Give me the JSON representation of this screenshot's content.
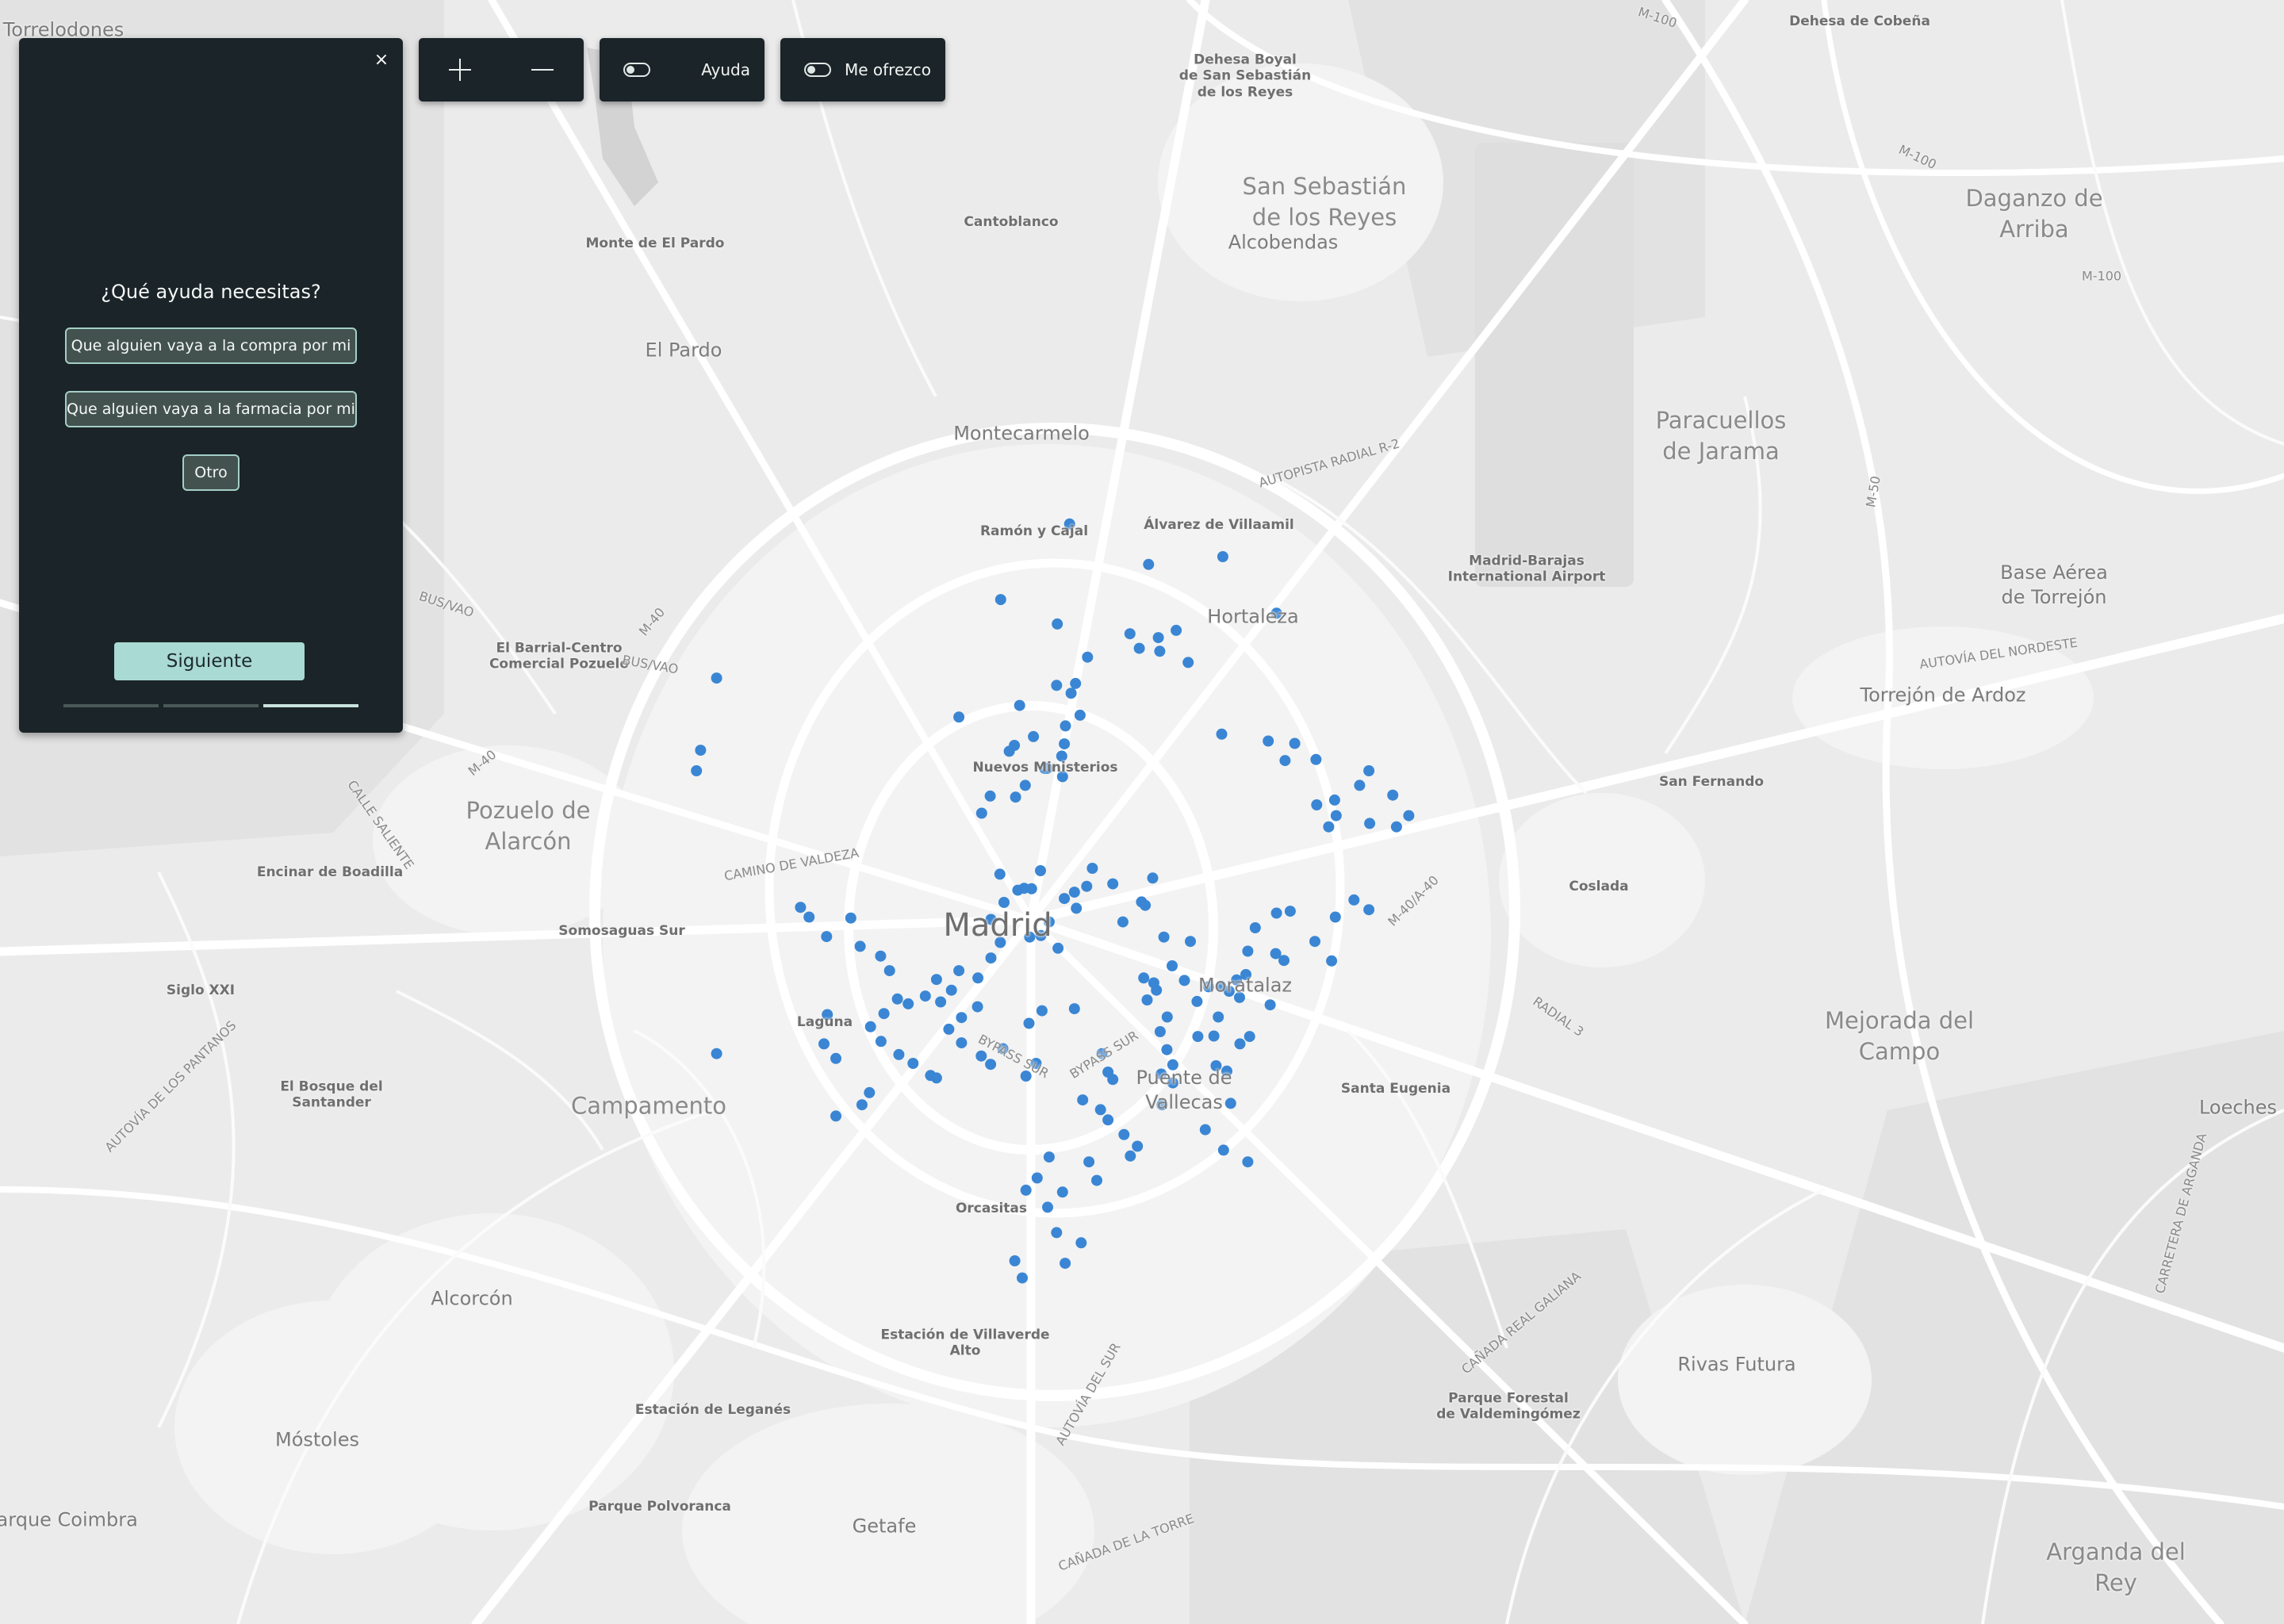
{
  "map": {
    "places": {
      "torrelodones": "Torrelodones",
      "dehesa_cobena": "Dehesa de Cobeña",
      "dehesa_boyal": "Dehesa Boyal\nde San Sebastián\nde los Reyes",
      "san_sebastian": "San Sebastián\nde los Reyes",
      "alcobendas": "Alcobendas",
      "daganzo": "Daganzo de\nArriba",
      "cantoblanco": "Cantoblanco",
      "monte_el_pardo": "Monte de El Pardo",
      "el_pardo": "El Pardo",
      "paracuellos": "Paracuellos\nde Jarama",
      "montecarmelo": "Montecarmelo",
      "ramon_y_cajal": "Ramón y Cajal",
      "alvarez_villaamil": "Álvarez de Villaamil",
      "madrid_barajas": "Madrid-Barajas\nInternational Airport",
      "base_aerea": "Base Aérea\nde Torrejón",
      "hortaleza": "Hortaleza",
      "el_barrial": "El Barrial-Centro\nComercial Pozuelo",
      "torrejon": "Torrejón de Ardoz",
      "nuevos_ministerios": "Nuevos Ministerios",
      "san_fernando": "San Fernando",
      "pozuelo": "Pozuelo de\nAlarcón",
      "encinar": "Encinar de Boadilla",
      "coslada": "Coslada",
      "somosaguas": "Somosaguas Sur",
      "madrid": "Madrid",
      "siglo_xxi": "Siglo XXI",
      "moratalaz": "Moratalaz",
      "laguna": "Laguna",
      "mejorada": "Mejorada del\nCampo",
      "el_bosque": "El Bosque del\nSantander",
      "puente_vallecas": "Puente de\nVallecas",
      "santa_eugenia": "Santa Eugenia",
      "campamento": "Campamento",
      "loeches": "Loeches",
      "orcasitas": "Orcasitas",
      "alcorcon": "Alcorcón",
      "villaverde": "Estación de Villaverde\nAlto",
      "rivas": "Rivas Futura",
      "parque_forestal": "Parque Forestal\nde Valdemingómez",
      "estacion_leganes": "Estación de Leganés",
      "mostoles": "Móstoles",
      "parque_polvoranca": "Parque Polvoranca",
      "getafe": "Getafe",
      "parque_coimbra": "Parque Coimbra",
      "arganda": "Arganda del\nRey"
    },
    "roads": {
      "m100a": "M-100",
      "m100b": "M-100",
      "m100c": "M-100",
      "r2": "AUTOPISTA RADIAL R-2",
      "m50": "M-50",
      "busvao1": "BUS/VAO",
      "busvao2": "BUS/VAO",
      "m40a": "M-40",
      "m40b": "M-40",
      "a2": "AUTOVÍA DEL NORDESTE",
      "calle_saliente": "CALLE SALIENTE",
      "camino_valdeza": "CAMINO DE VALDEZA",
      "a40_40": "M-40/A-40",
      "radial3": "RADIAL 3",
      "bypass_sur1": "BYPASS SUR",
      "bypass_sur2": "BYPASS SUR",
      "pantanos": "AUTOVÍA DE LOS PANTANOS",
      "canada_galiana": "CAÑADA REAL GALIANA",
      "autovia_sur": "AUTOVÍA DEL SUR",
      "canada_torre": "CAÑADA DE LA TORRE",
      "ctra_arganda": "CARRETERA DE ARGANDA"
    },
    "marker_color": "#3a86d4"
  },
  "controls": {
    "zoom_in_icon": "plus-icon",
    "zoom_out_icon": "minus-icon",
    "help_label": "Ayuda",
    "offer_label": "Me ofrezco"
  },
  "panel": {
    "close_symbol": "×",
    "question": "¿Qué ayuda necesitas?",
    "options": [
      "Que alguien vaya a la compra por mi",
      "Que alguien vaya a la farmacia por mi",
      "Otro"
    ],
    "next_label": "Siguiente",
    "progress": {
      "steps": 3,
      "current": 3
    }
  },
  "markers": [
    {
      "lat": 40.4996,
      "lon": -3.6843
    },
    {
      "lat": 40.4913,
      "lon": -3.6631
    },
    {
      "lat": 40.4929,
      "lon": -3.6432
    },
    {
      "lat": 40.4813,
      "lon": -3.6288
    },
    {
      "lat": 40.4841,
      "lon": -3.7028
    },
    {
      "lat": 40.4791,
      "lon": -3.6876
    },
    {
      "lat": 40.4723,
      "lon": -3.6795
    },
    {
      "lat": 40.4771,
      "lon": -3.6681
    },
    {
      "lat": 40.4741,
      "lon": -3.6656
    },
    {
      "lat": 40.4763,
      "lon": -3.6605
    },
    {
      "lat": 40.4735,
      "lon": -3.6601
    },
    {
      "lat": 40.4778,
      "lon": -3.6557
    },
    {
      "lat": 40.4712,
      "lon": -3.6525
    },
    {
      "lat": 40.4665,
      "lon": -3.6878
    },
    {
      "lat": 40.4649,
      "lon": -3.6839
    },
    {
      "lat": 40.4669,
      "lon": -3.6827
    },
    {
      "lat": 40.4624,
      "lon": -3.6977
    },
    {
      "lat": 40.4542,
      "lon": -3.6991
    },
    {
      "lat": 40.4545,
      "lon": -3.6857
    },
    {
      "lat": 40.4604,
      "lon": -3.6815
    },
    {
      "lat": 40.4582,
      "lon": -3.6854
    },
    {
      "lat": 40.452,
      "lon": -3.6864
    },
    {
      "lat": 40.4478,
      "lon": -3.6862
    },
    {
      "lat": 40.4495,
      "lon": -3.6903
    },
    {
      "lat": 40.446,
      "lon": -3.6962
    },
    {
      "lat": 40.453,
      "lon": -3.7005
    },
    {
      "lat": 40.4495,
      "lon": -3.691
    },
    {
      "lat": 40.456,
      "lon": -3.694
    },
    {
      "lat": 40.4436,
      "lon": -3.6988
    },
    {
      "lat": 40.4438,
      "lon": -3.7056
    },
    {
      "lat": 40.4403,
      "lon": -3.7079
    },
    {
      "lat": 40.4565,
      "lon": -3.6435
    },
    {
      "lat": 40.4551,
      "lon": -3.631
    },
    {
      "lat": 40.4511,
      "lon": -3.6265
    },
    {
      "lat": 40.4546,
      "lon": -3.6239
    },
    {
      "lat": 40.4513,
      "lon": -3.6182
    },
    {
      "lat": 40.443,
      "lon": -3.6132
    },
    {
      "lat": 40.4398,
      "lon": -3.6128
    },
    {
      "lat": 40.4375,
      "lon": -3.6148
    },
    {
      "lat": 40.4382,
      "lon": -3.6038
    },
    {
      "lat": 40.4375,
      "lon": -3.5966
    },
    {
      "lat": 40.4398,
      "lon": -3.5933
    },
    {
      "lat": 40.444,
      "lon": -3.5976
    },
    {
      "lat": 40.427,
      "lon": -3.662
    },
    {
      "lat": 40.4221,
      "lon": -3.665
    },
    {
      "lat": 40.4214,
      "lon": -3.664
    },
    {
      "lat": 40.418,
      "lon": -3.67
    },
    {
      "lat": 40.4258,
      "lon": -3.6727
    },
    {
      "lat": 40.429,
      "lon": -3.6782
    },
    {
      "lat": 40.4253,
      "lon": -3.6797
    },
    {
      "lat": 40.4241,
      "lon": -3.683
    },
    {
      "lat": 40.4208,
      "lon": -3.6825
    },
    {
      "lat": 40.4228,
      "lon": -3.6857
    },
    {
      "lat": 40.418,
      "lon": -3.6898
    },
    {
      "lat": 40.4126,
      "lon": -3.6874
    },
    {
      "lat": 40.4248,
      "lon": -3.6945
    },
    {
      "lat": 40.4249,
      "lon": -3.6965
    },
    {
      "lat": 40.4285,
      "lon": -3.6921
    },
    {
      "lat": 40.4245,
      "lon": -3.6982
    },
    {
      "lat": 40.422,
      "lon": -3.7019
    },
    {
      "lat": 40.4278,
      "lon": -3.703
    },
    {
      "lat": 40.4149,
      "lon": -3.695
    },
    {
      "lat": 40.4152,
      "lon": -3.692
    },
    {
      "lat": 40.4185,
      "lon": -3.7054
    },
    {
      "lat": 40.4138,
      "lon": -3.7029
    },
    {
      "lat": 40.4106,
      "lon": -3.7054
    },
    {
      "lat": 40.4065,
      "lon": -3.7089
    },
    {
      "lat": 40.4062,
      "lon": -3.72
    },
    {
      "lat": 40.4016,
      "lon": -3.7189
    },
    {
      "lat": 40.404,
      "lon": -3.716
    },
    {
      "lat": 40.408,
      "lon": -3.714
    },
    {
      "lat": 40.4028,
      "lon": -3.723
    },
    {
      "lat": 40.4012,
      "lon": -3.7276
    },
    {
      "lat": 40.3992,
      "lon": -3.7341
    },
    {
      "lat": 40.4022,
      "lon": -3.7305
    },
    {
      "lat": 40.3965,
      "lon": -3.7377
    },
    {
      "lat": 40.3935,
      "lon": -3.7349
    },
    {
      "lat": 40.3908,
      "lon": -3.7301
    },
    {
      "lat": 40.389,
      "lon": -3.7263
    },
    {
      "lat": 40.3865,
      "lon": -3.7216
    },
    {
      "lat": 40.386,
      "lon": -3.72
    },
    {
      "lat": 40.396,
      "lon": -3.7167
    },
    {
      "lat": 40.3932,
      "lon": -3.7133
    },
    {
      "lat": 40.3984,
      "lon": -3.7133
    },
    {
      "lat": 40.4006,
      "lon": -3.709
    },
    {
      "lat": 40.3905,
      "lon": -3.708
    },
    {
      "lat": 40.3888,
      "lon": -3.7055
    },
    {
      "lat": 40.392,
      "lon": -3.7022
    },
    {
      "lat": 40.3972,
      "lon": -3.6952
    },
    {
      "lat": 40.389,
      "lon": -3.6933
    },
    {
      "lat": 40.3864,
      "lon": -3.696
    },
    {
      "lat": 40.3998,
      "lon": -3.6917
    },
    {
      "lat": 40.4002,
      "lon": -3.683
    },
    {
      "lat": 40.391,
      "lon": -3.6756
    },
    {
      "lat": 40.3872,
      "lon": -3.674
    },
    {
      "lat": 40.3857,
      "lon": -3.6727
    },
    {
      "lat": 40.3815,
      "lon": -3.6808
    },
    {
      "lat": 40.3795,
      "lon": -3.676
    },
    {
      "lat": 40.3774,
      "lon": -3.674
    },
    {
      "lat": 40.3805,
      "lon": -3.6595
    },
    {
      "lat": 40.385,
      "lon": -3.6566
    },
    {
      "lat": 40.3868,
      "lon": -3.6597
    },
    {
      "lat": 40.3887,
      "lon": -3.6566
    },
    {
      "lat": 40.3918,
      "lon": -3.6582
    },
    {
      "lat": 40.3955,
      "lon": -3.66
    },
    {
      "lat": 40.3985,
      "lon": -3.6581
    },
    {
      "lat": 40.402,
      "lon": -3.6635
    },
    {
      "lat": 40.4055,
      "lon": -3.6617
    },
    {
      "lat": 40.4065,
      "lon": -3.6644
    },
    {
      "lat": 40.404,
      "lon": -3.661
    },
    {
      "lat": 40.409,
      "lon": -3.6568
    },
    {
      "lat": 40.414,
      "lon": -3.6519
    },
    {
      "lat": 40.4149,
      "lon": -3.659
    },
    {
      "lat": 40.406,
      "lon": -3.6535
    },
    {
      "lat": 40.4017,
      "lon": -3.6501
    },
    {
      "lat": 40.4047,
      "lon": -3.647
    },
    {
      "lat": 40.4048,
      "lon": -3.6437
    },
    {
      "lat": 40.4038,
      "lon": -3.6415
    },
    {
      "lat": 40.4061,
      "lon": -3.6395
    },
    {
      "lat": 40.4025,
      "lon": -3.6387
    },
    {
      "lat": 40.4072,
      "lon": -3.637
    },
    {
      "lat": 40.412,
      "lon": -3.6365
    },
    {
      "lat": 40.4168,
      "lon": -3.6345
    },
    {
      "lat": 40.4198,
      "lon": -3.6288
    },
    {
      "lat": 40.4202,
      "lon": -3.6251
    },
    {
      "lat": 40.4115,
      "lon": -3.629
    },
    {
      "lat": 40.4101,
      "lon": -3.6268
    },
    {
      "lat": 40.401,
      "lon": -3.6305
    },
    {
      "lat": 40.3945,
      "lon": -3.636
    },
    {
      "lat": 40.393,
      "lon": -3.6386
    },
    {
      "lat": 40.3946,
      "lon": -3.6456
    },
    {
      "lat": 40.3945,
      "lon": -3.6499
    },
    {
      "lat": 40.3985,
      "lon": -3.6444
    },
    {
      "lat": 40.3874,
      "lon": -3.6421
    },
    {
      "lat": 40.3885,
      "lon": -3.645
    },
    {
      "lat": 40.3754,
      "lon": -3.6479
    },
    {
      "lat": 40.3712,
      "lon": -3.643
    },
    {
      "lat": 40.3688,
      "lon": -3.6365
    },
    {
      "lat": 40.3808,
      "lon": -3.6411
    },
    {
      "lat": 40.37,
      "lon": -3.668
    },
    {
      "lat": 40.3744,
      "lon": -3.6697
    },
    {
      "lat": 40.372,
      "lon": -3.6661
    },
    {
      "lat": 40.3688,
      "lon": -3.6791
    },
    {
      "lat": 40.365,
      "lon": -3.677
    },
    {
      "lat": 40.3698,
      "lon": -3.6898
    },
    {
      "lat": 40.3655,
      "lon": -3.693
    },
    {
      "lat": 40.3626,
      "lon": -3.6862
    },
    {
      "lat": 40.363,
      "lon": -3.696
    },
    {
      "lat": 40.3595,
      "lon": -3.6902
    },
    {
      "lat": 40.3543,
      "lon": -3.6878
    },
    {
      "lat": 40.3522,
      "lon": -3.6812
    },
    {
      "lat": 40.3485,
      "lon": -3.699
    },
    {
      "lat": 40.348,
      "lon": -3.6855
    },
    {
      "lat": 40.345,
      "lon": -3.697
    },
    {
      "lat": 40.468,
      "lon": -3.779
    },
    {
      "lat": 40.4532,
      "lon": -3.7833
    },
    {
      "lat": 40.449,
      "lon": -3.7844
    },
    {
      "lat": 40.421,
      "lon": -3.7565
    },
    {
      "lat": 40.419,
      "lon": -3.7542
    },
    {
      "lat": 40.415,
      "lon": -3.7495
    },
    {
      "lat": 40.4188,
      "lon": -3.743
    },
    {
      "lat": 40.413,
      "lon": -3.7405
    },
    {
      "lat": 40.411,
      "lon": -3.735
    },
    {
      "lat": 40.408,
      "lon": -3.7326
    },
    {
      "lat": 40.399,
      "lon": -3.7493
    },
    {
      "lat": 40.393,
      "lon": -3.7502
    },
    {
      "lat": 40.39,
      "lon": -3.747
    },
    {
      "lat": 40.383,
      "lon": -3.738
    },
    {
      "lat": 40.3805,
      "lon": -3.74
    },
    {
      "lat": 40.3782,
      "lon": -3.747
    },
    {
      "lat": 40.391,
      "lon": -3.779
    },
    {
      "lat": 40.46,
      "lon": -3.714
    },
    {
      "lat": 40.449,
      "lon": -3.604
    },
    {
      "lat": 40.446,
      "lon": -3.6065
    },
    {
      "lat": 40.442,
      "lon": -3.618
    },
    {
      "lat": 40.414,
      "lon": -3.6185
    },
    {
      "lat": 40.41,
      "lon": -3.614
    },
    {
      "lat": 40.419,
      "lon": -3.613
    },
    {
      "lat": 40.4225,
      "lon": -3.608
    },
    {
      "lat": 40.4205,
      "lon": -3.604
    }
  ]
}
